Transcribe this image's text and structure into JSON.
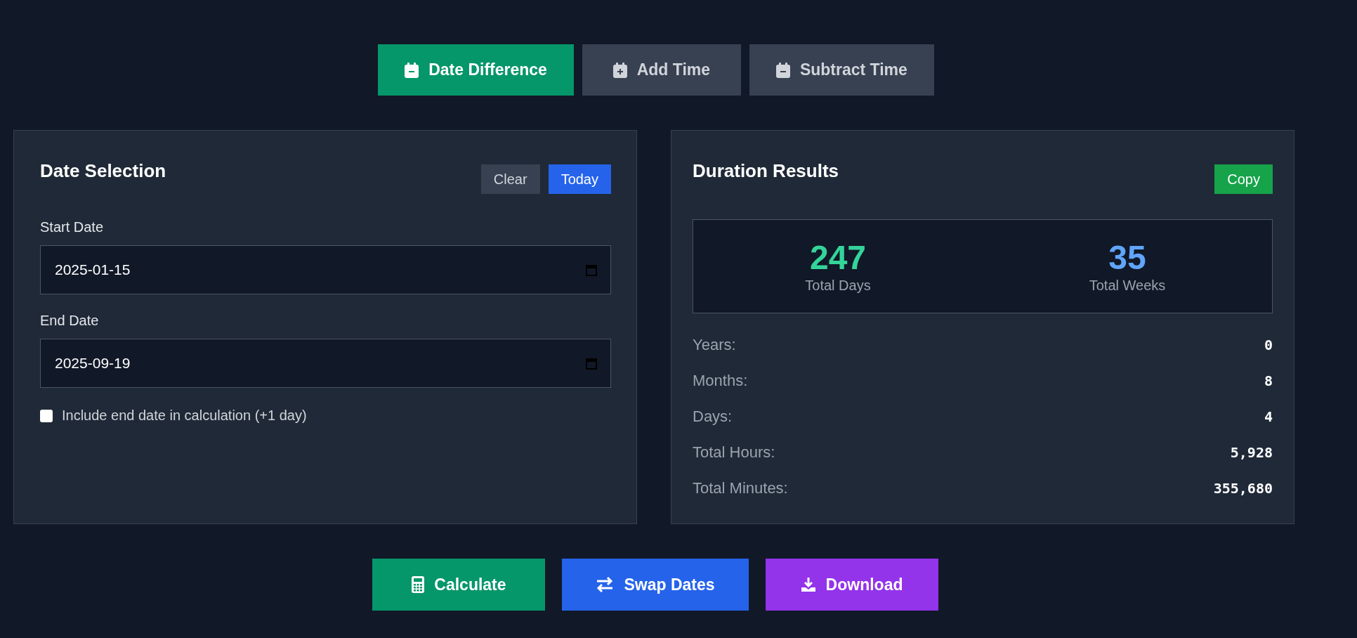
{
  "tabs": [
    {
      "label": "Date Difference",
      "kind": "difference",
      "selected": true
    },
    {
      "label": "Add Time",
      "kind": "add",
      "selected": false
    },
    {
      "label": "Subtract Time",
      "kind": "subtract",
      "selected": false
    }
  ],
  "date_selection": {
    "title": "Date Selection",
    "actions": [
      {
        "label": "Clear",
        "kind": "secondary"
      },
      {
        "label": "Today",
        "kind": "primary"
      }
    ],
    "fields": [
      {
        "label": "Start Date",
        "value": "2025-01-15"
      },
      {
        "label": "End Date",
        "value": "2025-09-19"
      }
    ],
    "include_end_date": {
      "label": "Include end date in calculation (+1 day)",
      "checked": false
    }
  },
  "results": {
    "title": "Duration Results",
    "copy_label": "Copy",
    "stats": [
      {
        "value": "247",
        "label": "Total Days",
        "color": "#34d399"
      },
      {
        "value": "35",
        "label": "Total Weeks",
        "color": "#60a5fa"
      }
    ],
    "rows": [
      {
        "label": "Years:",
        "value": "0"
      },
      {
        "label": "Months:",
        "value": "8"
      },
      {
        "label": "Days:",
        "value": "4"
      },
      {
        "label": "Total Hours:",
        "value": "5,928"
      },
      {
        "label": "Total Minutes:",
        "value": "355,680"
      }
    ]
  },
  "actions": [
    {
      "label": "Calculate",
      "kind": "calculate"
    },
    {
      "label": "Swap Dates",
      "kind": "swap"
    },
    {
      "label": "Download",
      "kind": "download"
    }
  ]
}
